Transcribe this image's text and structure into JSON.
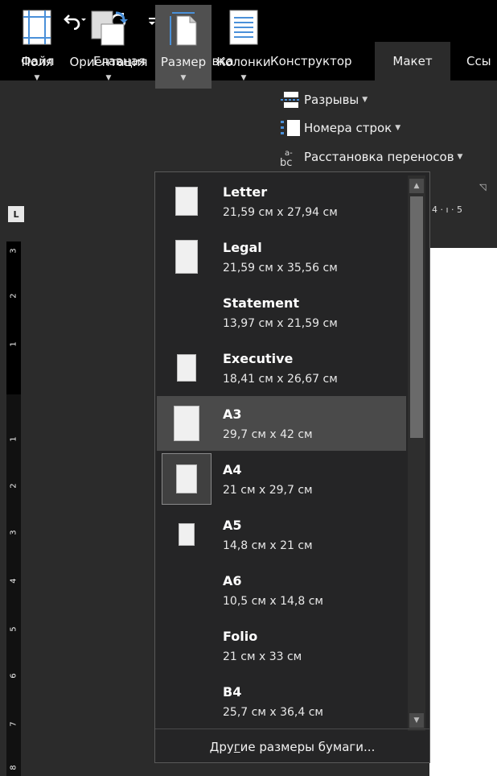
{
  "quick_access": {
    "save": "save-icon",
    "undo": "undo-icon",
    "redo": "redo-icon",
    "customize": "customize-icon"
  },
  "tabs": [
    {
      "label": "Файл"
    },
    {
      "label": "Главная"
    },
    {
      "label": "Вставка"
    },
    {
      "label": "Конструктор"
    },
    {
      "label": "Макет"
    },
    {
      "label": "Ссы"
    }
  ],
  "active_tab": "Макет",
  "ribbon": {
    "margins": "Поля",
    "orientation": "Ориентация",
    "size": "Размер",
    "columns": "Колонки",
    "breaks": "Разрывы",
    "line_numbers": "Номера строк",
    "hyphenation": "Расстановка переносов"
  },
  "ruler": {
    "corner": "L",
    "h_ticks": "· 4 · ı · 5",
    "v_numbers": [
      "3",
      "2",
      "1",
      "1",
      "2",
      "3",
      "4",
      "5",
      "6",
      "7",
      "8"
    ]
  },
  "paper_sizes": [
    {
      "name": "Letter",
      "size": "21,59 см x 27,94 см"
    },
    {
      "name": "Legal",
      "size": "21,59 см x 35,56 см"
    },
    {
      "name": "Statement",
      "size": "13,97 см x 21,59 см"
    },
    {
      "name": "Executive",
      "size": "18,41 см x 26,67 см"
    },
    {
      "name": "A3",
      "size": "29,7 см x 42 см"
    },
    {
      "name": "A4",
      "size": "21 см x 29,7 см"
    },
    {
      "name": "A5",
      "size": "14,8 см x 21 см"
    },
    {
      "name": "A6",
      "size": "10,5 см x 14,8 см"
    },
    {
      "name": "Folio",
      "size": "21 см x 33 см"
    },
    {
      "name": "B4",
      "size": "25,7 см x 36,4 см"
    }
  ],
  "hovered_item": "A3",
  "selected_item": "A4",
  "more_sizes": {
    "prefix": "Дру",
    "accel": "г",
    "suffix": "ие размеры бумаги..."
  },
  "colors": {
    "background": "#2b2b2b",
    "accent": "#4a90d9",
    "hover": "#4a4a4a"
  }
}
